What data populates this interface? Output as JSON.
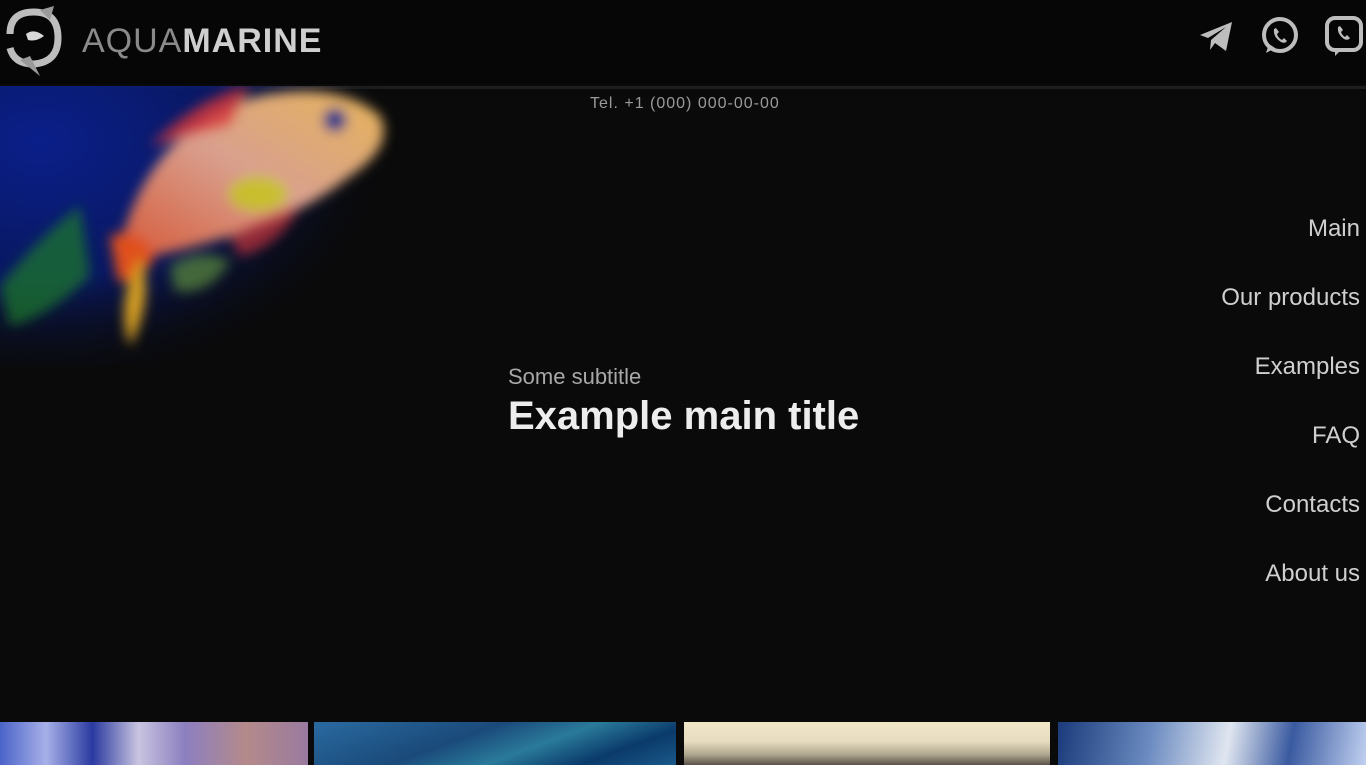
{
  "brand": {
    "name_light": "AQUA",
    "name_bold": "MARINE"
  },
  "header": {
    "phone": "Tel. +1 (000) 000-00-00",
    "icons": [
      "telegram-icon",
      "whatsapp-icon",
      "viber-icon"
    ]
  },
  "hero": {
    "subtitle": "Some subtitle",
    "title": "Example main title"
  },
  "nav": {
    "items": [
      "Main",
      "Our products",
      "Examples",
      "FAQ",
      "Contacts",
      "About us"
    ]
  },
  "thumbnails": [
    "thumbnail-1",
    "thumbnail-2",
    "thumbnail-3",
    "thumbnail-4"
  ],
  "colors": {
    "background": "#0a0a0a",
    "fish_bg": "#0a1a6a",
    "text": "#ededed"
  }
}
